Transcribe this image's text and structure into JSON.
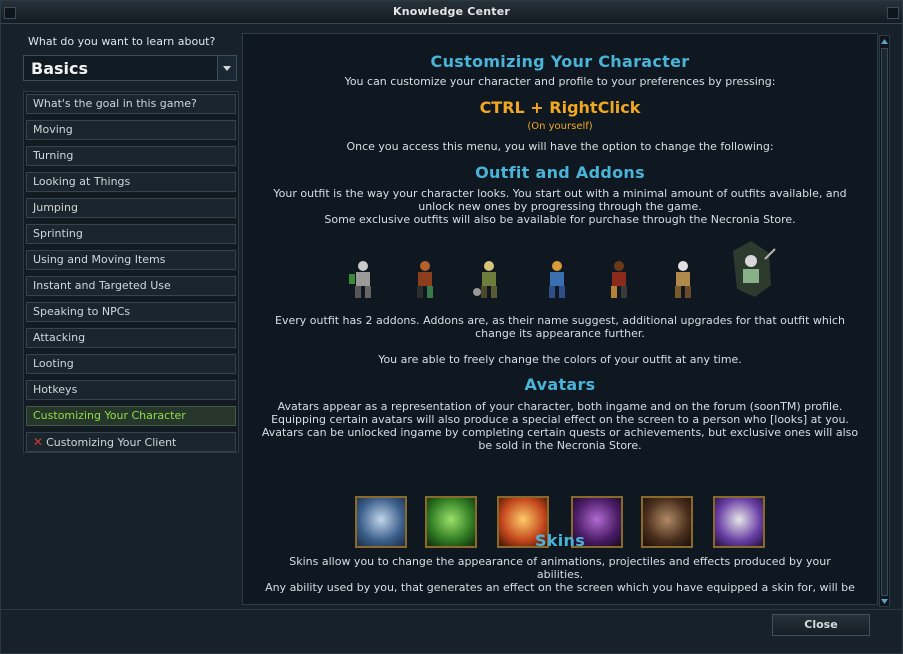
{
  "window": {
    "title": "Knowledge Center"
  },
  "left": {
    "prompt": "What do you want to learn about?",
    "category_value": "Basics",
    "topics": [
      {
        "label": "What's the goal in this game?"
      },
      {
        "label": "Moving"
      },
      {
        "label": "Turning"
      },
      {
        "label": "Looking at Things"
      },
      {
        "label": "Jumping"
      },
      {
        "label": "Sprinting"
      },
      {
        "label": "Using and Moving Items"
      },
      {
        "label": "Instant and Targeted Use"
      },
      {
        "label": "Speaking to NPCs"
      },
      {
        "label": "Attacking"
      },
      {
        "label": "Looting"
      },
      {
        "label": "Hotkeys"
      },
      {
        "label": "Customizing Your Character"
      },
      {
        "label": "Customizing Your Client"
      }
    ]
  },
  "content": {
    "h_customize": "Customizing Your Character",
    "p_customize": "You can customize your character and profile to your preferences by pressing:",
    "ctrl": "CTRL + RightClick",
    "on_yourself": "(On yourself)",
    "p_access": "Once you access this menu, you will have the option to change the following:",
    "h_outfit": "Outfit and Addons",
    "p_outfit1": "Your outfit is the way your character looks. You start out with a minimal amount of outfits available, and",
    "p_outfit2": "unlock new ones by progressing through the game.",
    "p_outfit3": "Some exclusive outfits will also be available for purchase through the Necronia Store.",
    "p_addons1": "Every outfit has 2 addons. Addons are, as their name suggest, additional upgrades for that outfit which",
    "p_addons2": "change its appearance further.",
    "p_colors": "You are able to freely change the colors of your outfit at any time.",
    "h_avatars": "Avatars",
    "p_av1": "Avatars appear as a representation of your character, both ingame and on the forum (soonTM) profile.",
    "p_av2": "Equipping certain avatars will also produce a special effect on the screen to a person who [looks] at you.",
    "p_av3": "Avatars can be unlocked ingame by completing certain quests or achievements, but exclusive ones will also",
    "p_av4": "be sold in the Necronia Store.",
    "h_skins": "Skins",
    "p_sk1": "Skins allow you to change the appearance of animations, projectiles and effects produced by your",
    "p_sk2": "abilities.",
    "p_sk3": "Any ability used by you, that generates an effect on the screen which you have equipped a skin for, will be"
  },
  "footer": {
    "close_label": "Close"
  }
}
